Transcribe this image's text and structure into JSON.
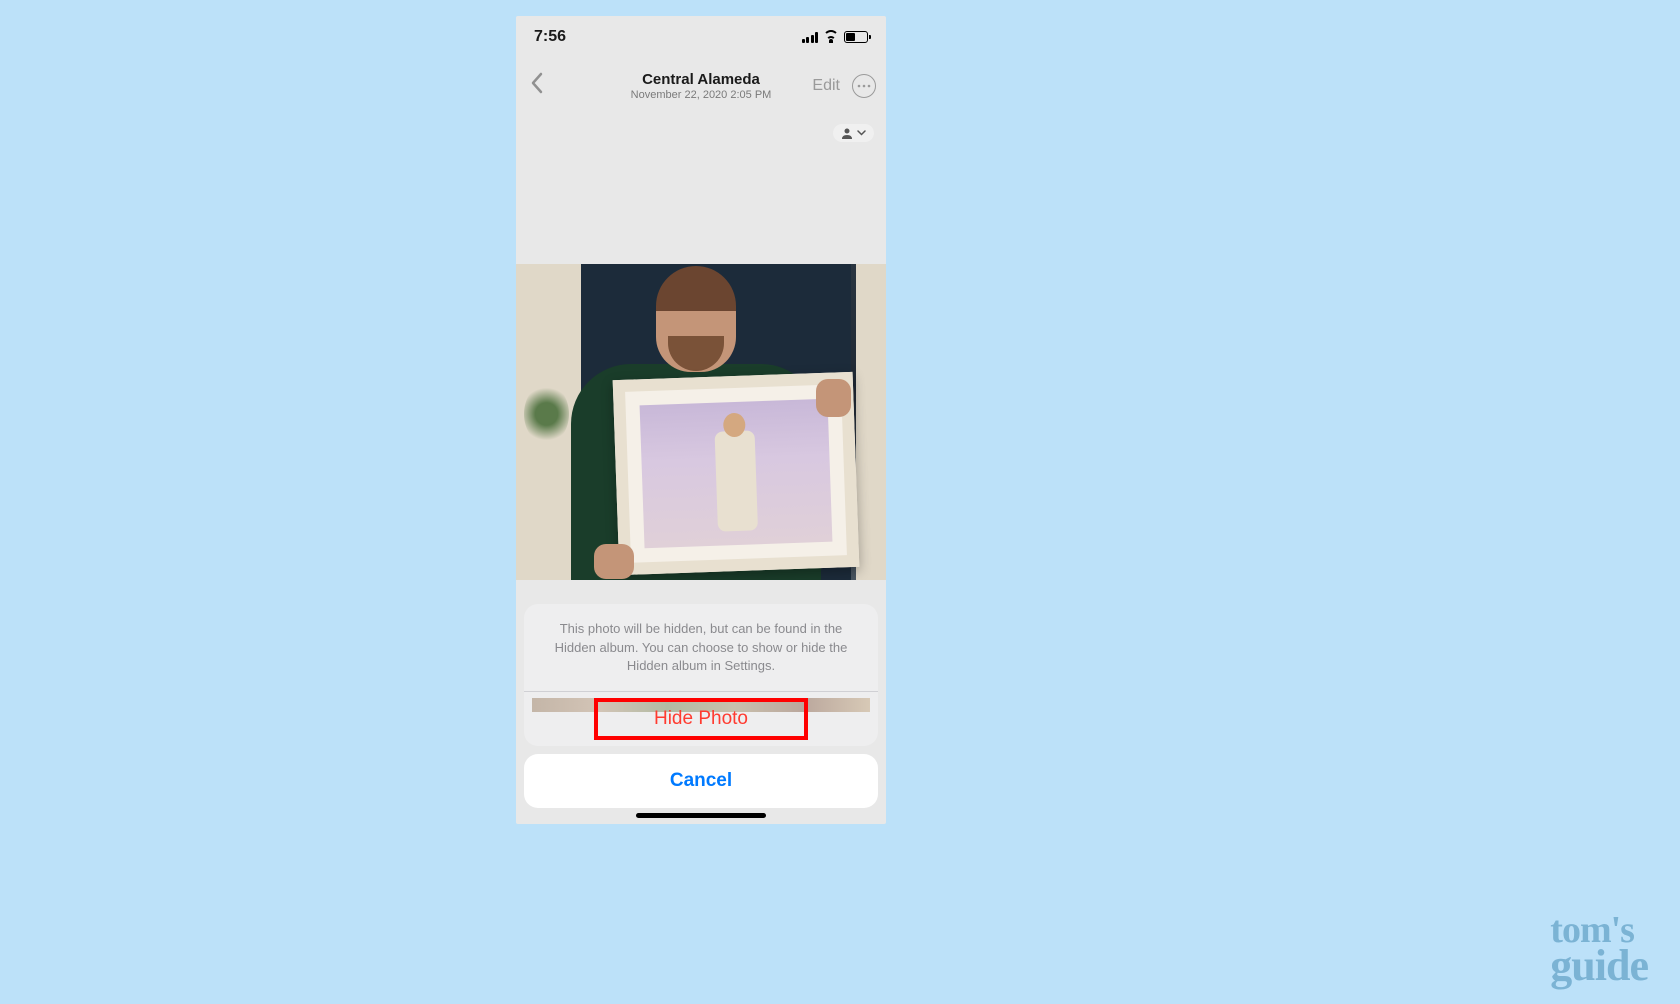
{
  "status": {
    "time": "7:56"
  },
  "nav": {
    "title": "Central Alameda",
    "subtitle": "November 22, 2020  2:05 PM",
    "edit": "Edit"
  },
  "sheet": {
    "message": "This photo will be hidden, but can be found in the Hidden album. You can choose to show or hide the Hidden album in Settings.",
    "hide": "Hide Photo",
    "cancel": "Cancel"
  },
  "watermark": {
    "line1": "tom's",
    "line2": "guide"
  }
}
